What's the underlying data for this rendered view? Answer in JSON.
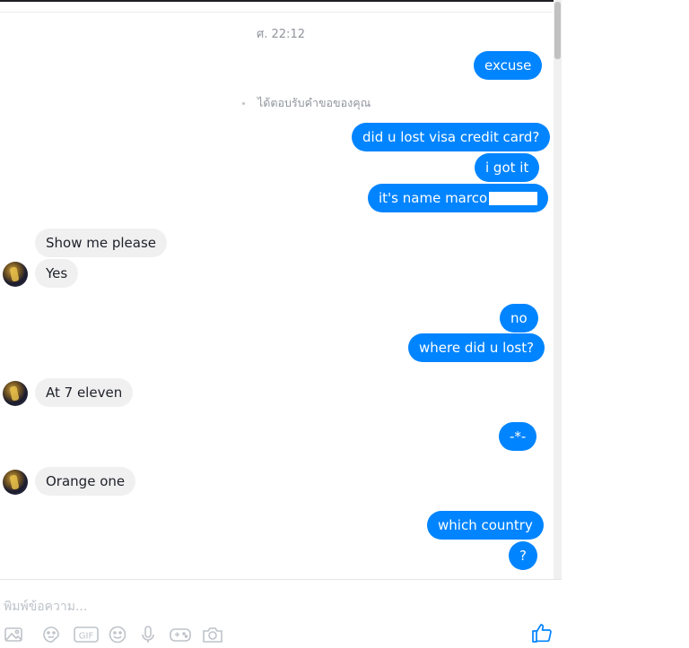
{
  "chat": {
    "timestamp": "ศ. 22:12",
    "notice": "ได้ตอบรับคำขอของคุณ",
    "messages": {
      "m1": "excuse",
      "m2": "did u lost visa credit card?",
      "m3": "i got it",
      "m4": "it's name marco",
      "m5": "Show me please",
      "m6": "Yes",
      "m7": "no",
      "m8": "where did u lost?",
      "m9": "At 7 eleven",
      "m10": "-*-",
      "m11": "Orange one",
      "m12": "which country",
      "m13": "?"
    }
  },
  "composer": {
    "placeholder": "พิมพ์ข้อความ...",
    "gif_label": "GIF"
  },
  "colors": {
    "outgoing": "#0084ff",
    "incoming": "#f1f0f0",
    "icon": "#bec3c9",
    "like": "#0084ff"
  },
  "icons": [
    "image-icon",
    "sticker-icon",
    "gif-icon",
    "emoji-icon",
    "microphone-icon",
    "game-icon",
    "camera-icon",
    "thumbs-up-icon"
  ]
}
